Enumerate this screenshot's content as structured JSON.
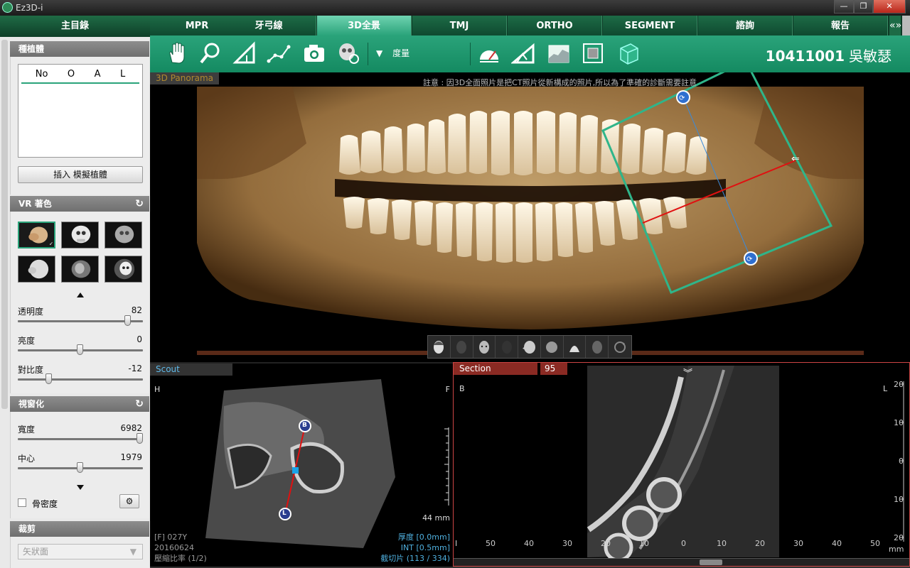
{
  "window": {
    "title": "Ez3D-i",
    "controls": {
      "minimize": "—",
      "maximize": "❐",
      "close": "✕"
    }
  },
  "left_panel": {
    "main_menu": "主目錄",
    "implant": {
      "title": "種植體",
      "columns": [
        "No",
        "O",
        "A",
        "L"
      ],
      "insert_button": "插入 模擬植體"
    },
    "vr_color": {
      "title": "VR 著色",
      "presets": [
        "skin-tone",
        "bone-white",
        "bone-gray",
        "skin-gray",
        "mixed",
        "skull-dark"
      ],
      "selected_index": 0,
      "sliders": [
        {
          "label": "透明度",
          "value": "82",
          "level": 0.88
        },
        {
          "label": "亮度",
          "value": "0",
          "level": 0.5
        },
        {
          "label": "對比度",
          "value": "-12",
          "level": 0.25
        }
      ]
    },
    "windowing": {
      "title": "視窗化",
      "sliders": [
        {
          "label": "寬度",
          "value": "6982",
          "level": 0.98
        },
        {
          "label": "中心",
          "value": "1979",
          "level": 0.5
        }
      ],
      "bone_density_label": "骨密度",
      "bone_density_checked": false
    },
    "crop": {
      "title": "裁剪",
      "select_value": "矢狀面"
    }
  },
  "tabs": [
    "MPR",
    "牙弓線",
    "3D全景",
    "TMJ",
    "ORTHO",
    "SEGMENT",
    "諮詢",
    "報告"
  ],
  "active_tab": "3D全景",
  "tabs_more": "«»",
  "toolbar": {
    "tools": [
      "hand-icon",
      "zoom-icon",
      "angle-icon",
      "polyline-icon",
      "camera-icon",
      "nerve-icon"
    ],
    "measure_label": "度量",
    "tools_right": [
      "gauge-icon",
      "ruler-angle-icon",
      "histogram-icon",
      "crop-icon",
      "cube-icon"
    ],
    "patient_id": "10411001",
    "patient_name": "吳敏瑟"
  },
  "panorama": {
    "label": "3D Panorama",
    "note": "註意 : 因3D全面照片是把CT照片從新構成的照片,所以為了準確的診斷需要註意"
  },
  "view_buttons": [
    "view-front",
    "view-back",
    "view-front-face",
    "view-back-face",
    "view-left",
    "view-top",
    "view-bottom",
    "view-right",
    "view-rotate"
  ],
  "scout": {
    "label": "Scout",
    "corner_left": "H",
    "corner_right": "F",
    "scale": "44 mm",
    "info_left": [
      "[F] 027Y",
      "20160624",
      "壓縮比率 (1/2)"
    ],
    "info_right": [
      "厚度 [0.0mm]",
      "INT [0.5mm]",
      "截切片 (113 / 334)"
    ],
    "markers": {
      "top": "B",
      "bottom": "L"
    }
  },
  "section": {
    "label": "Section",
    "slice_number": "95",
    "corner_left": "B",
    "corner_right": "L",
    "y_ticks": [
      "20",
      "10",
      "0",
      "10",
      "20"
    ],
    "x_ticks": [
      "I",
      "50",
      "40",
      "30",
      "20",
      "10",
      "0",
      "10",
      "20",
      "30",
      "40",
      "50"
    ],
    "unit": "mm",
    "chevron": "︾"
  }
}
